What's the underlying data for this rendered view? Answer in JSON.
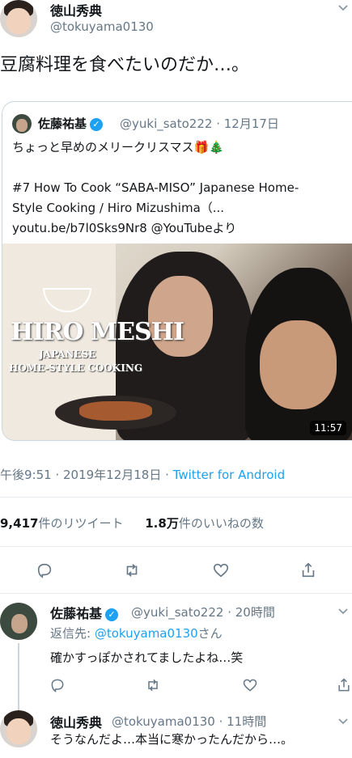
{
  "main_tweet": {
    "author_name": "徳山秀典",
    "author_handle": "@tokuyama0130",
    "text": "豆腐料理を食べたいのだか…。",
    "timestamp": "午後9:51 · 2019年12月18日",
    "source_sep": " · ",
    "source": "Twitter for Android"
  },
  "quoted_tweet": {
    "author_name": "佐藤祐基",
    "author_handle": "@yuki_sato222 · 12月17日",
    "text": "ちょっと早めのメリークリスマス🎁🎄\n\n#7 How To Cook “SABA-MISO” Japanese Home-\nStyle Cooking / Hiro Mizushima（...\nyoutu.be/b7l0Sks9Nr8 @YouTubeより",
    "video": {
      "logo": "HIRO MESHI",
      "subtitle_1": "JAPANESE",
      "subtitle_2": "HOME-STYLE COOKING",
      "duration": "11:57"
    }
  },
  "stats": {
    "retweets_count": "9,417",
    "retweets_label": "件のリツイート",
    "likes_count": "1.8万",
    "likes_label": "件のいいねの数"
  },
  "replies": [
    {
      "author_name": "佐藤祐基",
      "author_handle": "@yuki_sato222 · 20時間",
      "reply_to_label": "返信先: ",
      "reply_to_handle": "@tokuyama0130",
      "reply_to_suffix": "さん",
      "text": "確かすっぽかされてましたよね…笑"
    },
    {
      "author_name": "徳山秀典",
      "author_handle": "@tokuyama0130 · 11時間",
      "text": "そうなんだよ…本当に寒かったんだから…。"
    }
  ],
  "icons": {
    "reply": "reply-icon",
    "retweet": "retweet-icon",
    "like": "heart-icon",
    "share": "share-icon",
    "menu": "chevron-down-icon",
    "verified": "verified-badge-icon"
  },
  "colors": {
    "link": "#1da1f2",
    "secondary_text": "#657786",
    "primary_text": "#14171a",
    "divider": "#e6ecf0"
  }
}
